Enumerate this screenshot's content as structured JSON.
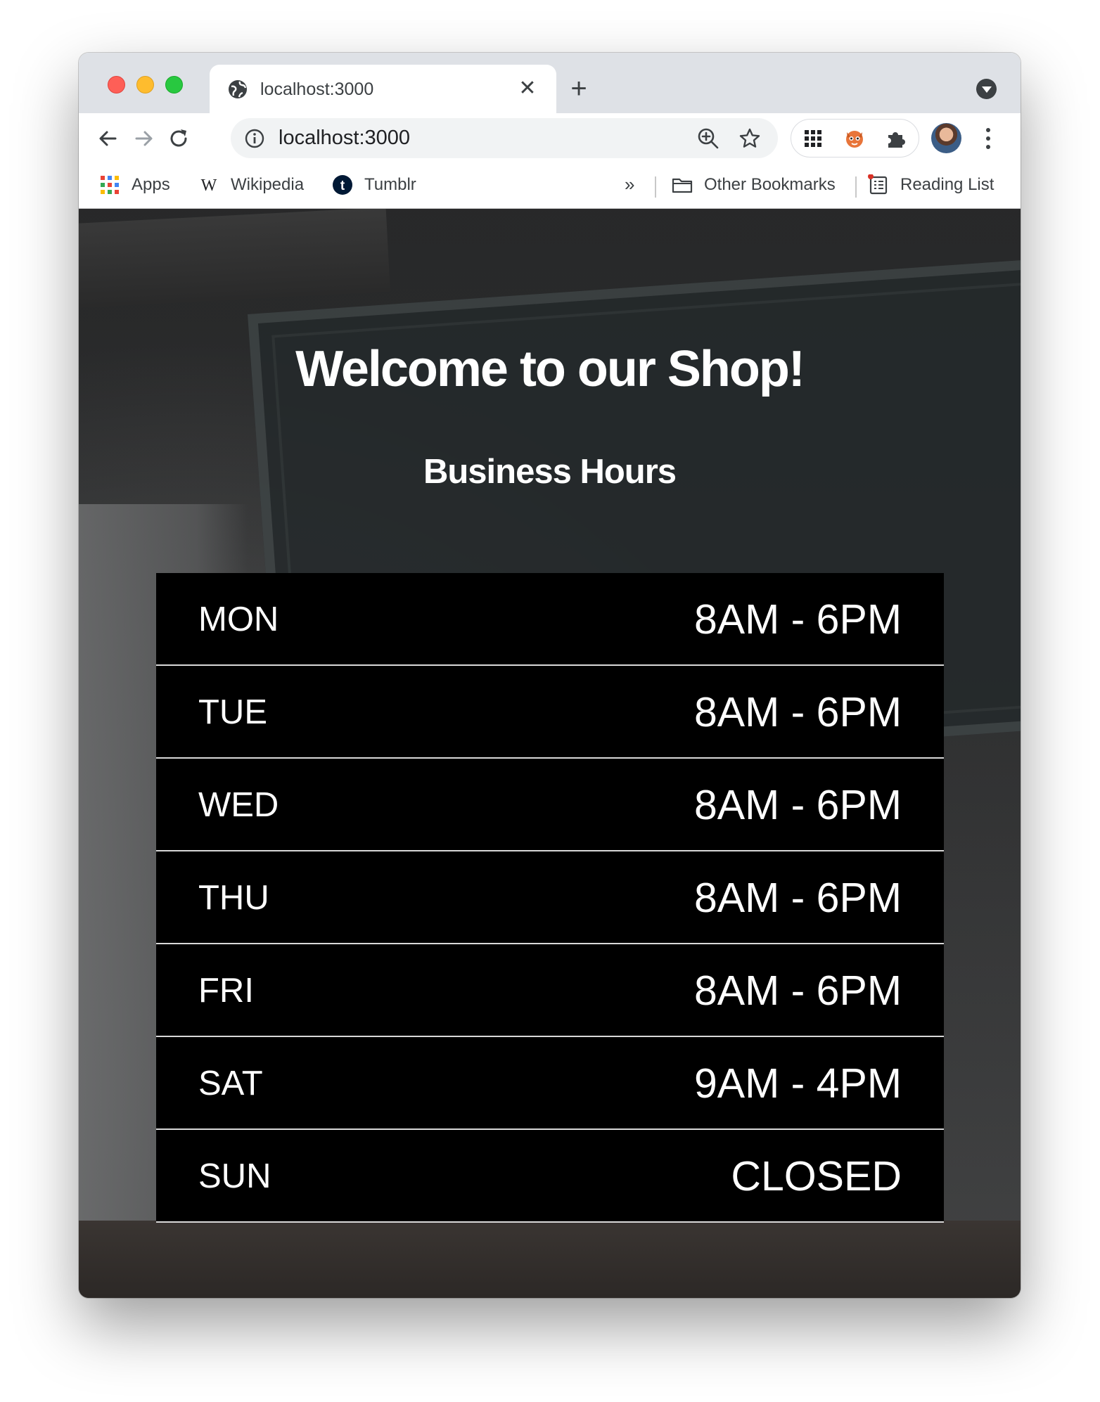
{
  "browser": {
    "tab_title": "localhost:3000",
    "tab_close": "✕",
    "new_tab": "+",
    "url": "localhost:3000",
    "bookmarks": [
      {
        "label": "Apps",
        "icon": "apps-grid-icon"
      },
      {
        "label": "Wikipedia",
        "icon": "wikipedia-icon"
      },
      {
        "label": "Tumblr",
        "icon": "tumblr-icon"
      }
    ],
    "more_bookmarks": "»",
    "other_bookmarks": "Other Bookmarks",
    "reading_list": "Reading List"
  },
  "page": {
    "title": "Welcome to our Shop!",
    "subtitle": "Business Hours",
    "hours": [
      {
        "day": "MON",
        "time": "8AM - 6PM"
      },
      {
        "day": "TUE",
        "time": "8AM - 6PM"
      },
      {
        "day": "WED",
        "time": "8AM - 6PM"
      },
      {
        "day": "THU",
        "time": "8AM - 6PM"
      },
      {
        "day": "FRI",
        "time": "8AM - 6PM"
      },
      {
        "day": "SAT",
        "time": "9AM - 4PM"
      },
      {
        "day": "SUN",
        "time": "CLOSED"
      }
    ]
  },
  "colors": {
    "row_background": "#000000",
    "text": "#ffffff",
    "row_divider": "#d9d9d9"
  }
}
